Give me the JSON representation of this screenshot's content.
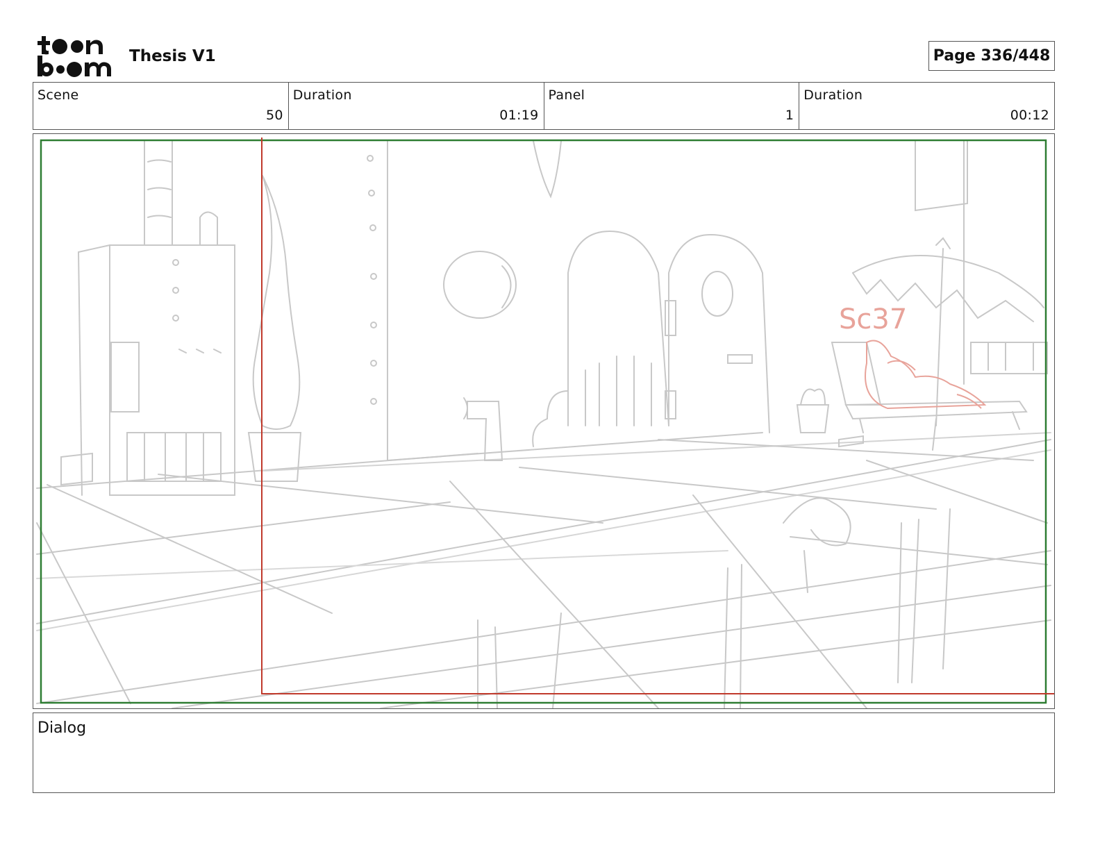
{
  "header": {
    "logo_text": "toon boom",
    "project_title": "Thesis V1",
    "page_label": "Page 336/448"
  },
  "info": {
    "scene_label": "Scene",
    "scene_value": "50",
    "scene_duration_label": "Duration",
    "scene_duration_value": "01:19",
    "panel_label": "Panel",
    "panel_value": "1",
    "panel_duration_label": "Duration",
    "panel_duration_value": "00:12"
  },
  "panel": {
    "annotation": "Sc37",
    "safe_frame_color": "#2e7d32",
    "camera_frame_color": "#c0392b",
    "annotation_color": "#e8a39a",
    "sketch_color": "#c8c8c8"
  },
  "dialog": {
    "label": "Dialog"
  }
}
